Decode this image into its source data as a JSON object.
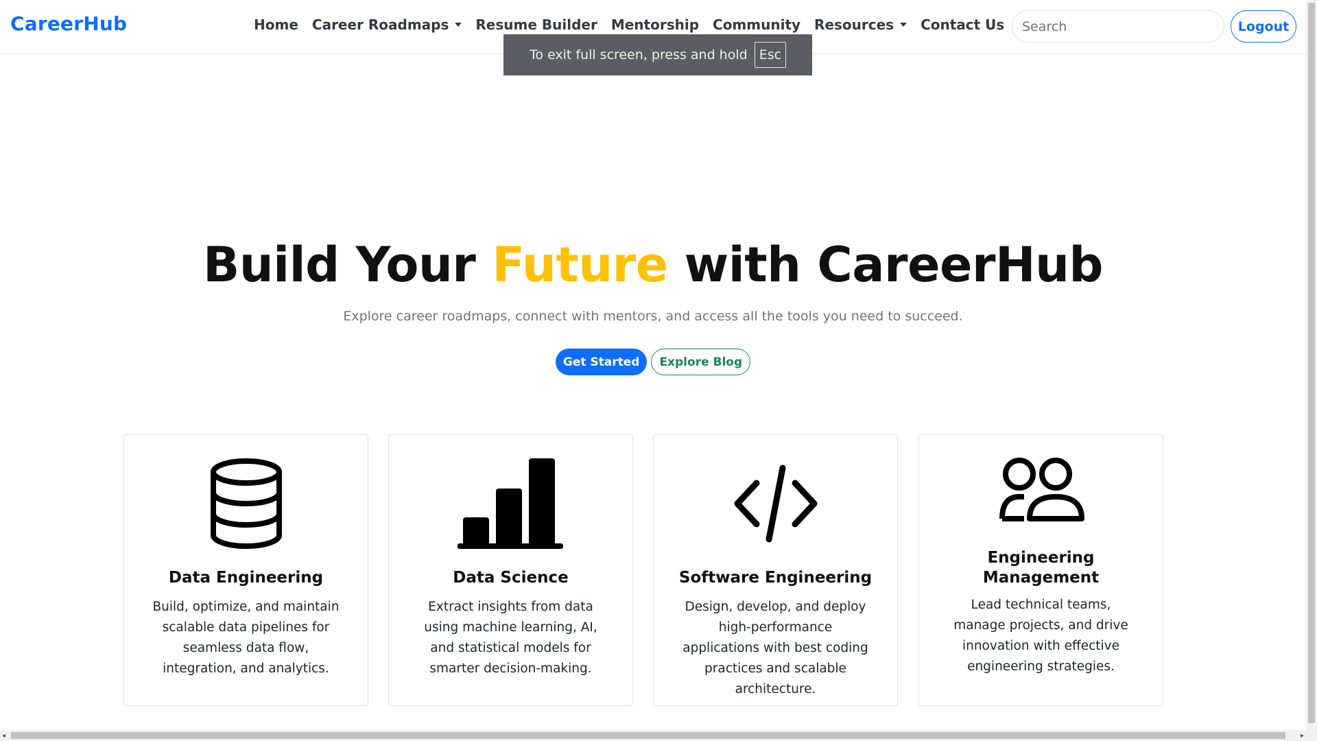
{
  "brand": {
    "name": "CareerHub",
    "color": "#0d6efd"
  },
  "nav": {
    "items": [
      {
        "label": "Home",
        "dropdown": false
      },
      {
        "label": "Career Roadmaps",
        "dropdown": true
      },
      {
        "label": "Resume Builder",
        "dropdown": false
      },
      {
        "label": "Mentorship",
        "dropdown": false
      },
      {
        "label": "Community",
        "dropdown": false
      },
      {
        "label": "Resources",
        "dropdown": true
      },
      {
        "label": "Contact Us",
        "dropdown": false
      }
    ],
    "search_placeholder": "Search",
    "logout_label": "Logout"
  },
  "fullscreen_toast": {
    "text": "To exit full screen, press and hold",
    "key": "Esc"
  },
  "hero": {
    "title_before": "Build Your",
    "title_accent": "Future",
    "title_after": "with CareerHub",
    "accent_color": "#ffc107",
    "subtitle": "Explore career roadmaps, connect with mentors, and access all the tools you need to succeed.",
    "primary_button": "Get Started",
    "secondary_button": "Explore Blog"
  },
  "cards": [
    {
      "icon": "database-icon",
      "title": "Data Engineering",
      "description": "Build, optimize, and maintain scalable data pipelines for seamless data flow, integration, and analytics."
    },
    {
      "icon": "bar-chart-icon",
      "title": "Data Science",
      "description": "Extract insights from data using machine learning, AI, and statistical models for smarter decision-making."
    },
    {
      "icon": "code-icon",
      "title": "Software Engineering",
      "description": "Design, develop, and deploy high-performance applications with best coding practices and scalable architecture."
    },
    {
      "icon": "people-icon",
      "title": "Engineering Management",
      "description": "Lead technical teams, manage projects, and drive innovation with effective engineering strategies."
    }
  ]
}
